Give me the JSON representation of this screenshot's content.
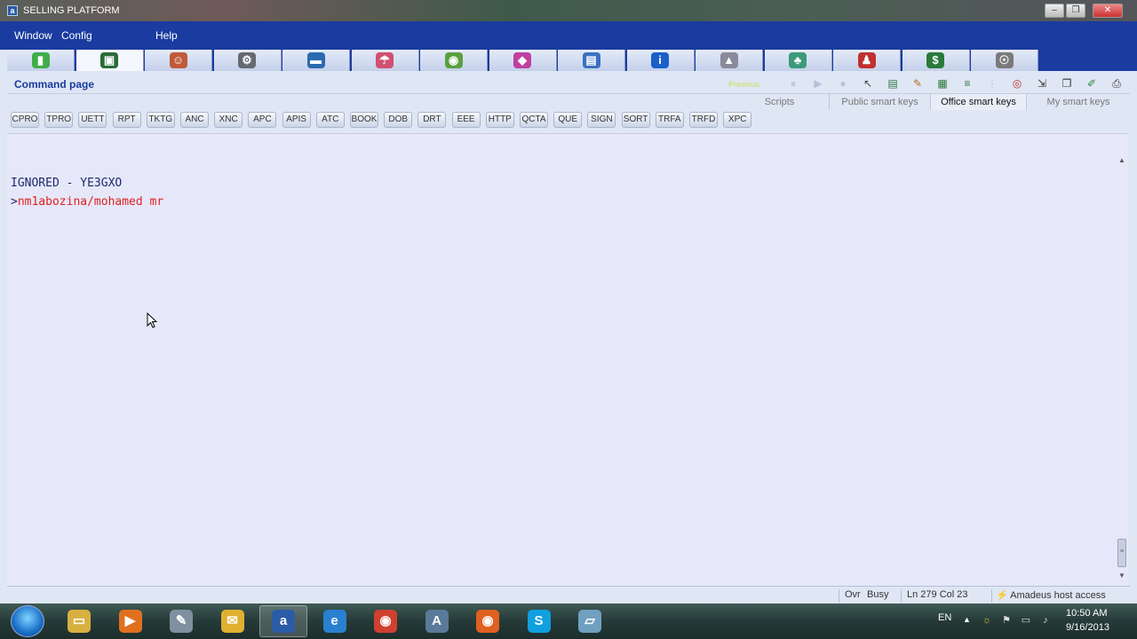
{
  "window": {
    "title": "SELLING PLATFORM",
    "icon_letter": "a"
  },
  "menu": {
    "items": [
      "Window",
      "Config",
      "Help"
    ]
  },
  "toolbar": {
    "tools": [
      {
        "name": "book-icon",
        "color": "#3fae4a",
        "glyph": "▮"
      },
      {
        "name": "command-page-icon",
        "color": "#2a6b3a",
        "glyph": "▣"
      },
      {
        "name": "agent-icon",
        "color": "#c05a3a",
        "glyph": "☺"
      },
      {
        "name": "tools-icon",
        "color": "#666a70",
        "glyph": "⚙"
      },
      {
        "name": "car-icon",
        "color": "#2a6ab0",
        "glyph": "▬"
      },
      {
        "name": "umbrella-icon",
        "color": "#d05070",
        "glyph": "☂"
      },
      {
        "name": "globe-icon",
        "color": "#5aa040",
        "glyph": "◉"
      },
      {
        "name": "ticket-icon",
        "color": "#c040a0",
        "glyph": "◆"
      },
      {
        "name": "document-icon",
        "color": "#3a70c0",
        "glyph": "▤"
      },
      {
        "name": "info-icon",
        "color": "#1a60c8",
        "glyph": "i"
      },
      {
        "name": "ship-icon",
        "color": "#8a8a9a",
        "glyph": "▲"
      },
      {
        "name": "tree-icon",
        "color": "#3a9a7a",
        "glyph": "♣"
      },
      {
        "name": "person-icon",
        "color": "#c03030",
        "glyph": "♟"
      },
      {
        "name": "money-icon",
        "color": "#2a7a3a",
        "glyph": "$"
      },
      {
        "name": "search-people-icon",
        "color": "#7a7a7a",
        "glyph": "☉"
      }
    ]
  },
  "command_page": {
    "title": "Command page",
    "previous_label": "Previous"
  },
  "smart_tabs": [
    "Scripts",
    "Public smart keys",
    "Office smart keys",
    "My smart keys"
  ],
  "active_smart_tab": "Office smart keys",
  "keys": [
    "CPRO",
    "TPRO",
    "UETT",
    "RPT",
    "TKTG",
    "ANC",
    "XNC",
    "APC",
    "APIS",
    "ATC",
    "BOOK",
    "DOB",
    "DRT",
    "EEE",
    "HTTP",
    "QCTA",
    "QUE",
    "SIGN",
    "SORT",
    "TRFA",
    "TRFD",
    "XPC"
  ],
  "terminal": {
    "line1": "IGNORED - YE3GXO",
    "prompt": ">",
    "line2": "nm1abozina/mohamed mr"
  },
  "status": {
    "ovr": "Ovr",
    "busy": "Busy",
    "position": "Ln 279 Col 23",
    "host": "Amadeus host access"
  },
  "taskbar": {
    "language": "EN",
    "time": "10:50 AM",
    "date": "9/16/2013",
    "apps": [
      {
        "name": "explorer-icon",
        "color": "#d8b040",
        "glyph": "▭"
      },
      {
        "name": "media-player-icon",
        "color": "#e07020",
        "glyph": "▶"
      },
      {
        "name": "paint-icon",
        "color": "#8090a0",
        "glyph": "✎"
      },
      {
        "name": "mail-icon",
        "color": "#e0b030",
        "glyph": "✉"
      },
      {
        "name": "amadeus-icon",
        "color": "#2a5ca8",
        "glyph": "a"
      },
      {
        "name": "internet-explorer-icon",
        "color": "#2a80d0",
        "glyph": "e"
      },
      {
        "name": "chrome-icon",
        "color": "#d04030",
        "glyph": "◉"
      },
      {
        "name": "asc-icon",
        "color": "#5a7a9a",
        "glyph": "A"
      },
      {
        "name": "firefox-icon",
        "color": "#e06020",
        "glyph": "◉"
      },
      {
        "name": "skype-icon",
        "color": "#10a0e0",
        "glyph": "S"
      },
      {
        "name": "notepad-icon",
        "color": "#70a0c0",
        "glyph": "▱"
      }
    ]
  }
}
